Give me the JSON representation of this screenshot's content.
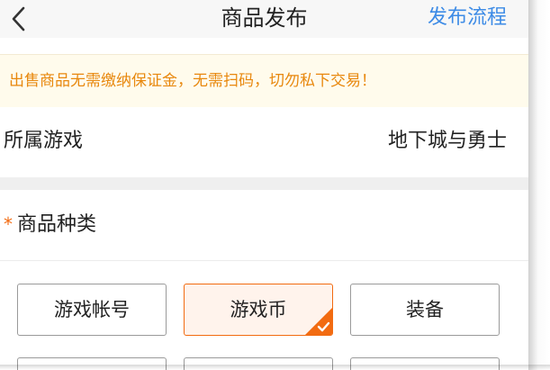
{
  "header": {
    "back_icon": "chevron-left-icon",
    "title": "商品发布",
    "flow_link": "发布流程",
    "accent_color": "#3d8be6"
  },
  "notice": {
    "text": "出售商品无需缴纳保证金，无需扫码，切勿私下交易！",
    "color": "#e8880e"
  },
  "game_row": {
    "label": "所属游戏",
    "value": "地下城与勇士"
  },
  "category": {
    "required_mark": "*",
    "label": "商品种类",
    "options": [
      {
        "label": "游戏帐号",
        "selected": false
      },
      {
        "label": "游戏币",
        "selected": true
      },
      {
        "label": "装备",
        "selected": false
      }
    ],
    "selected_color": "#f26b11",
    "check_icon": "check-icon"
  }
}
